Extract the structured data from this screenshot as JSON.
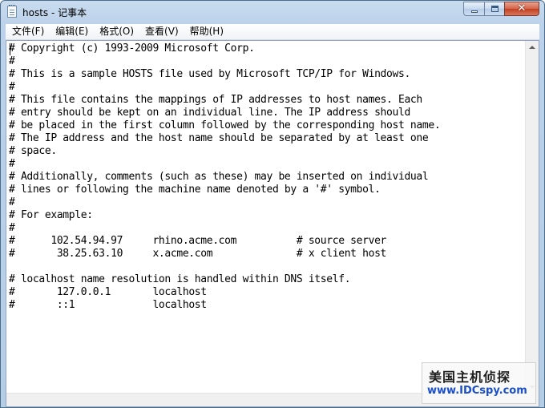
{
  "window": {
    "title": "hosts - 记事本",
    "close_glyph": "✕"
  },
  "menu": {
    "items": [
      "文件(F)",
      "编辑(E)",
      "格式(O)",
      "查看(V)",
      "帮助(H)"
    ]
  },
  "document": {
    "lines": [
      "# Copyright (c) 1993-2009 Microsoft Corp.",
      "#",
      "# This is a sample HOSTS file used by Microsoft TCP/IP for Windows.",
      "#",
      "# This file contains the mappings of IP addresses to host names. Each",
      "# entry should be kept on an individual line. The IP address should",
      "# be placed in the first column followed by the corresponding host name.",
      "# The IP address and the host name should be separated by at least one",
      "# space.",
      "#",
      "# Additionally, comments (such as these) may be inserted on individual",
      "# lines or following the machine name denoted by a '#' symbol.",
      "#",
      "# For example:",
      "#",
      "#      102.54.94.97     rhino.acme.com          # source server",
      "#       38.25.63.10     x.acme.com              # x client host",
      "",
      "# localhost name resolution is handled within DNS itself.",
      "#\t127.0.0.1       localhost",
      "#\t::1             localhost"
    ]
  },
  "watermark": {
    "name": "美国主机侦探",
    "url": "www.IDCspy.com"
  },
  "icons": {
    "app": "notepad-icon",
    "minimize": "minimize-icon",
    "maximize": "maximize-icon",
    "close": "close-icon",
    "scroll_up": "arrow-up-icon",
    "scroll_down": "arrow-down-icon"
  }
}
